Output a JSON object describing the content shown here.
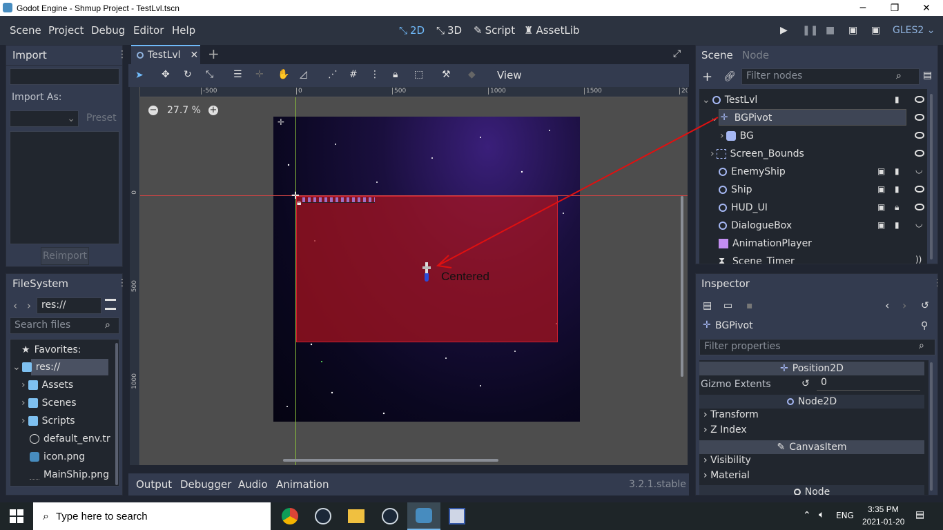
{
  "window": {
    "title": "Godot Engine - Shmup Project - TestLvl.tscn",
    "minimize": "─",
    "maximize": "❐",
    "close": "✕"
  },
  "menu": {
    "items": [
      "Scene",
      "Project",
      "Debug",
      "Editor",
      "Help"
    ]
  },
  "workspaces": {
    "items": [
      "2D",
      "3D",
      "Script",
      "AssetLib"
    ],
    "active": "2D"
  },
  "renderer": "GLES2",
  "import_dock": {
    "title": "Import",
    "import_as_label": "Import As:",
    "preset_label": "Preset",
    "reimport_label": "Reimport"
  },
  "filesystem": {
    "title": "FileSystem",
    "path": "res://",
    "search_placeholder": "Search files",
    "favorites": "Favorites:",
    "root": "res://",
    "items": [
      "Assets",
      "Scenes",
      "Scripts",
      "default_env.tr",
      "icon.png",
      "MainShip.png"
    ]
  },
  "tabs": {
    "scene_tab": "TestLvl",
    "add": "+"
  },
  "toolbar": {
    "view_label": "View"
  },
  "viewport": {
    "zoom": "27.7 %",
    "ruler_top": [
      "-500",
      "0",
      "500",
      "1000",
      "1500",
      "20"
    ],
    "ruler_left": [
      "0",
      "500",
      "1000"
    ],
    "label": "Centered"
  },
  "bottom_panel": {
    "items": [
      "Output",
      "Debugger",
      "Audio",
      "Animation"
    ],
    "version": "3.2.1.stable"
  },
  "scene_dock": {
    "tabs": [
      "Scene",
      "Node"
    ],
    "filter_placeholder": "Filter nodes",
    "nodes": [
      {
        "name": "TestLvl"
      },
      {
        "name": "BGPivot"
      },
      {
        "name": "BG"
      },
      {
        "name": "Screen_Bounds"
      },
      {
        "name": "EnemyShip"
      },
      {
        "name": "Ship"
      },
      {
        "name": "HUD_UI"
      },
      {
        "name": "DialogueBox"
      },
      {
        "name": "AnimationPlayer"
      },
      {
        "name": "Scene_Timer"
      }
    ]
  },
  "inspector": {
    "title": "Inspector",
    "node": "BGPivot",
    "filter_placeholder": "Filter properties",
    "section1": "Position2D",
    "prop_label": "Gizmo Extents",
    "prop_value": "0",
    "section2": "Node2D",
    "groups1": [
      "Transform",
      "Z Index"
    ],
    "section3": "CanvasItem",
    "groups2": [
      "Visibility",
      "Material"
    ],
    "section4": "Node"
  },
  "taskbar": {
    "search_placeholder": "Type here to search",
    "lang": "ENG",
    "time": "3:35 PM",
    "date": "2021-01-20"
  },
  "colors": {
    "accent": "#70bafa",
    "panel": "#333b4f",
    "annotation": "#e01010"
  }
}
